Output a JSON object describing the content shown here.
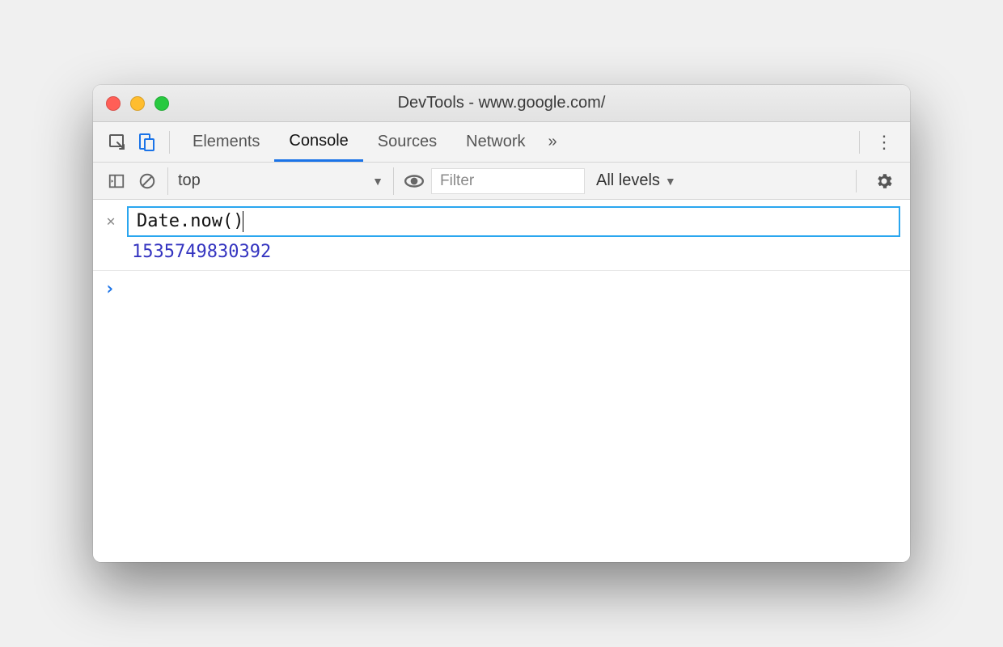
{
  "window": {
    "title": "DevTools - www.google.com/"
  },
  "tabs": {
    "items": [
      "Elements",
      "Console",
      "Sources",
      "Network"
    ],
    "active": "Console",
    "overflow": "»"
  },
  "console_toolbar": {
    "context": "top",
    "filter_placeholder": "Filter",
    "levels_label": "All levels"
  },
  "live_expression": {
    "expression": "Date.now()",
    "result": "1535749830392"
  },
  "prompt": {
    "caret": "›"
  }
}
